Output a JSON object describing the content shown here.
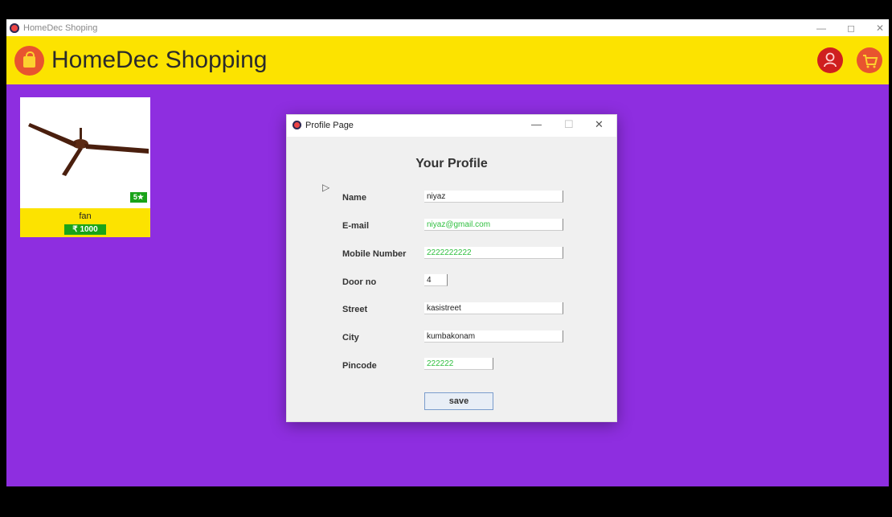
{
  "window": {
    "title": "HomeDec Shoping",
    "controls": [
      "—",
      "◻",
      "✕"
    ]
  },
  "header": {
    "brand": "HomeDec Shopping"
  },
  "product": {
    "name": "fan",
    "rating": "5★",
    "price": "₹ 1000"
  },
  "dialog": {
    "title": "Profile Page",
    "controls": [
      "—",
      "☐",
      "✕"
    ],
    "heading": "Your Profile",
    "labels": {
      "name": "Name",
      "email": "E-mail",
      "mobile": "Mobile Number",
      "door": "Door no",
      "street": "Street",
      "city": "City",
      "pincode": "Pincode"
    },
    "values": {
      "name": "niyaz",
      "email": "niyaz@gmail.com",
      "mobile": "2222222222",
      "door": "4",
      "street": "kasistreet",
      "city": "kumbakonam",
      "pincode": "222222"
    },
    "save_label": "save"
  },
  "colors": {
    "background": "#8e2ee0",
    "header": "#fce300",
    "badge": "#19a319"
  }
}
